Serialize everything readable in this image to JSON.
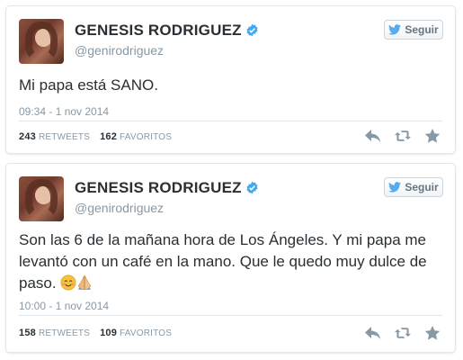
{
  "tweets": [
    {
      "display_name": "GENESIS RODRIGUEZ",
      "handle": "@genirodriguez",
      "follow_label": "Seguir",
      "text": "Mi papa está SANO.",
      "timestamp": "09:34 - 1 nov 2014",
      "retweets_count": "243",
      "retweets_label": "RETWEETS",
      "favorites_count": "162",
      "favorites_label": "FAVORITOS"
    },
    {
      "display_name": "GENESIS RODRIGUEZ",
      "handle": "@genirodriguez",
      "follow_label": "Seguir",
      "text": "Son las 6 de la mañana hora de Los Ángeles. Y mi papa me levantó con un café en la mano. Que le quedo muy dulce de paso.",
      "timestamp": "10:00 - 1 nov 2014",
      "retweets_count": "158",
      "retweets_label": "RETWEETS",
      "favorites_count": "109",
      "favorites_label": "FAVORITOS"
    }
  ],
  "icons": {
    "verified": "verified-badge-icon",
    "follow": "twitter-bird-icon",
    "reply": "reply-icon",
    "retweet": "retweet-icon",
    "favorite": "star-icon",
    "emoji_1": "smiling-face-icon",
    "emoji_2": "praying-hands-icon"
  },
  "colors": {
    "brand": "#55acee",
    "verified": "#3fa9f5",
    "text": "#292f33",
    "muted": "#8899a6"
  }
}
